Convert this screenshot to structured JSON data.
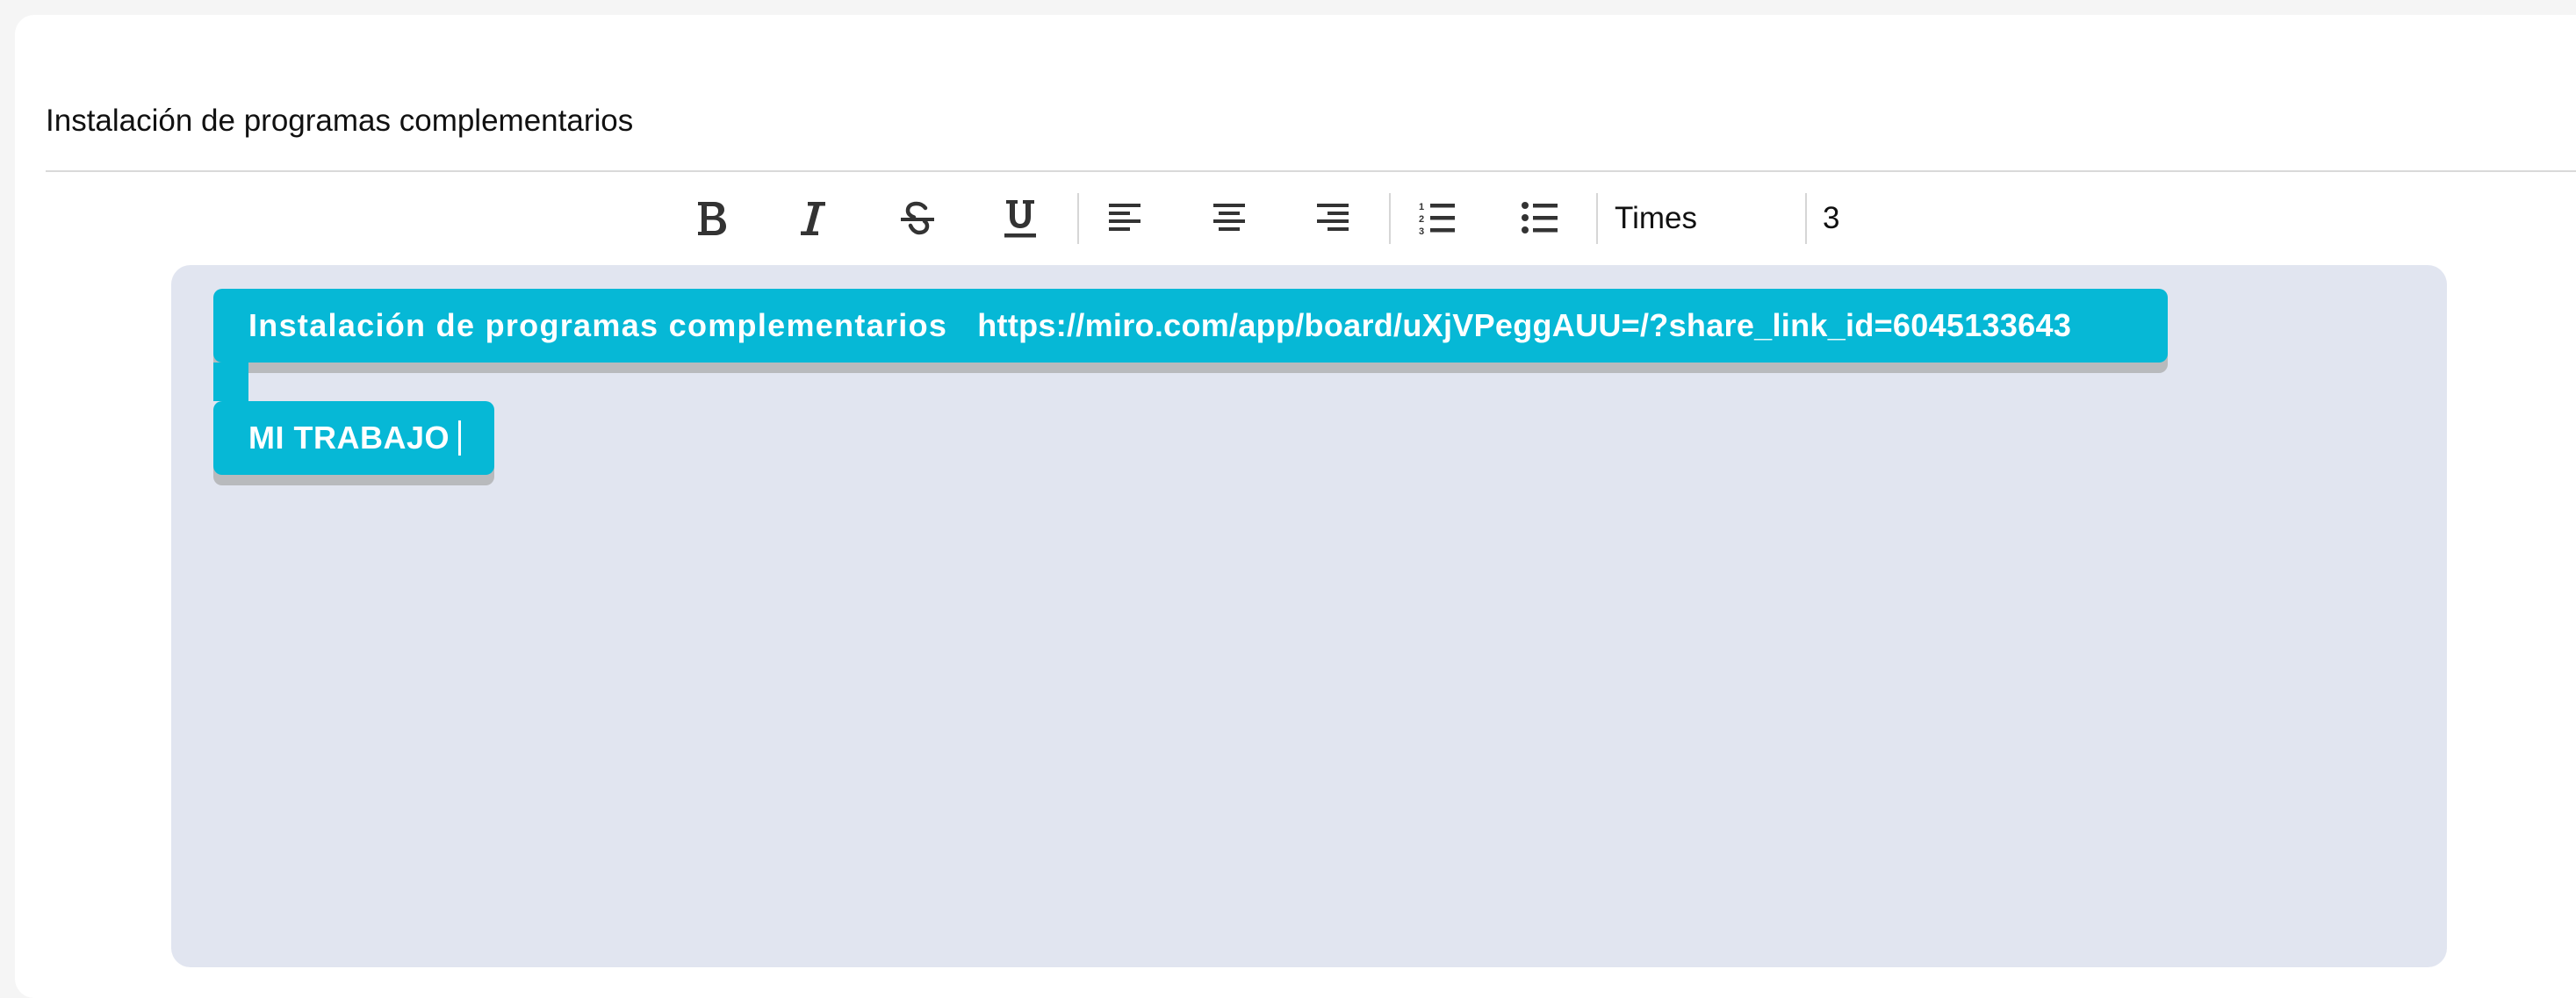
{
  "section": {
    "title": "Instalación de programas complementarios"
  },
  "toolbar": {
    "buttons": [
      {
        "id": "bold",
        "icon": "bold-icon"
      },
      {
        "id": "italic",
        "icon": "italic-icon"
      },
      {
        "id": "strikethrough",
        "icon": "strikethrough-icon"
      },
      {
        "id": "underline",
        "icon": "underline-icon"
      },
      {
        "id": "align-left",
        "icon": "align-left-icon"
      },
      {
        "id": "align-center",
        "icon": "align-center-icon"
      },
      {
        "id": "align-right",
        "icon": "align-right-icon"
      },
      {
        "id": "ordered-list",
        "icon": "ordered-list-icon"
      },
      {
        "id": "bullet-list",
        "icon": "bullet-list-icon"
      }
    ],
    "font_family": "Times",
    "font_size": "3"
  },
  "editor": {
    "lines": [
      {
        "text": "Instalación de programas complementarios",
        "link": "https://miro.com/app/board/uXjVPeggAUU=/?share_link_id=6045133643"
      },
      {
        "text": "MI TRABAJO"
      }
    ],
    "highlight_color": "#06b8d6",
    "background_color": "#e1e5f0"
  },
  "colors": {
    "icon": "#333333",
    "text": "#111111"
  }
}
